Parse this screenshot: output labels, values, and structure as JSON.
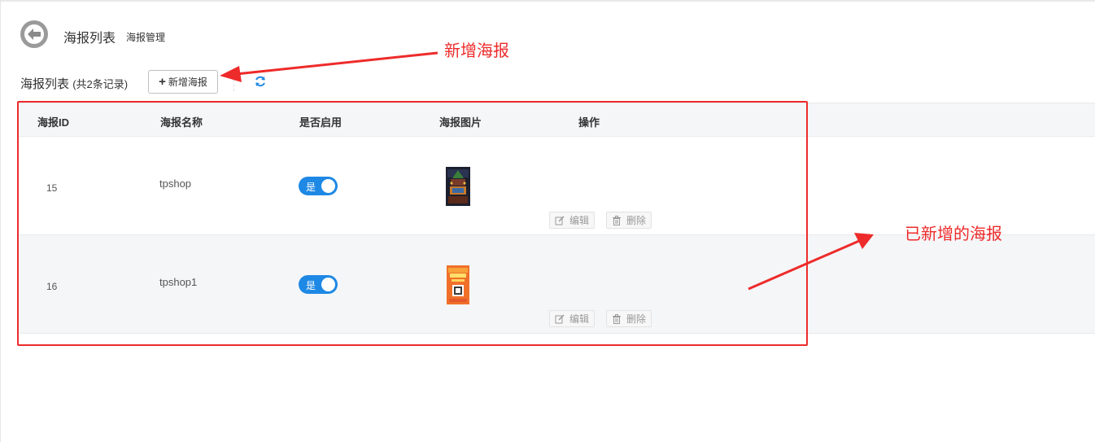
{
  "header": {
    "title": "海报列表",
    "subtitle": "海报管理"
  },
  "toolbar": {
    "list_title": "海报列表",
    "count_text": "(共2条记录)",
    "add_button": "新增海报"
  },
  "table": {
    "columns": [
      "海报ID",
      "海报名称",
      "是否启用",
      "海报图片",
      "操作"
    ],
    "rows": [
      {
        "id": "15",
        "name": "tpshop",
        "enabled_label": "是",
        "enabled": true,
        "edit": "编辑",
        "delete": "删除"
      },
      {
        "id": "16",
        "name": "tpshop1",
        "enabled_label": "是",
        "enabled": true,
        "edit": "编辑",
        "delete": "删除"
      }
    ]
  },
  "annotations": {
    "add_label": "新增海报",
    "added_label": "已新增的海报"
  },
  "colors": {
    "accent": "#1e88e5",
    "annotation": "#ee2b2b"
  }
}
